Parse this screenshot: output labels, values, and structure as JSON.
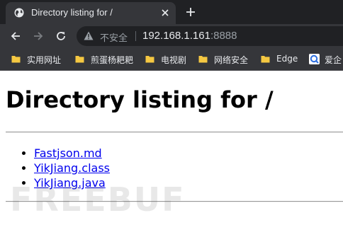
{
  "tab": {
    "title": "Directory listing for /",
    "favicon": "globe-icon"
  },
  "toolbar": {
    "security_label": "不安全",
    "url_host": "192.168.1.161",
    "url_port": ":8888"
  },
  "bookmarks": [
    {
      "label": "实用网址",
      "icon": "folder-icon"
    },
    {
      "label": "煎蛋杨耙耙",
      "icon": "folder-icon"
    },
    {
      "label": "电视剧",
      "icon": "folder-icon"
    },
    {
      "label": "网络安全",
      "icon": "folder-icon"
    },
    {
      "label": "Edge",
      "icon": "folder-icon"
    },
    {
      "label": "爱企",
      "icon": "site-icon"
    }
  ],
  "page": {
    "heading": "Directory listing for /",
    "files": [
      "Fastjson.md",
      "YikJiang.class",
      "YikJiang.java"
    ]
  },
  "watermark": "FREEBUF",
  "colors": {
    "chrome_dark": "#202124",
    "chrome_toolbar": "#35363a",
    "link": "#0000ee",
    "folder": "#f5c842"
  }
}
